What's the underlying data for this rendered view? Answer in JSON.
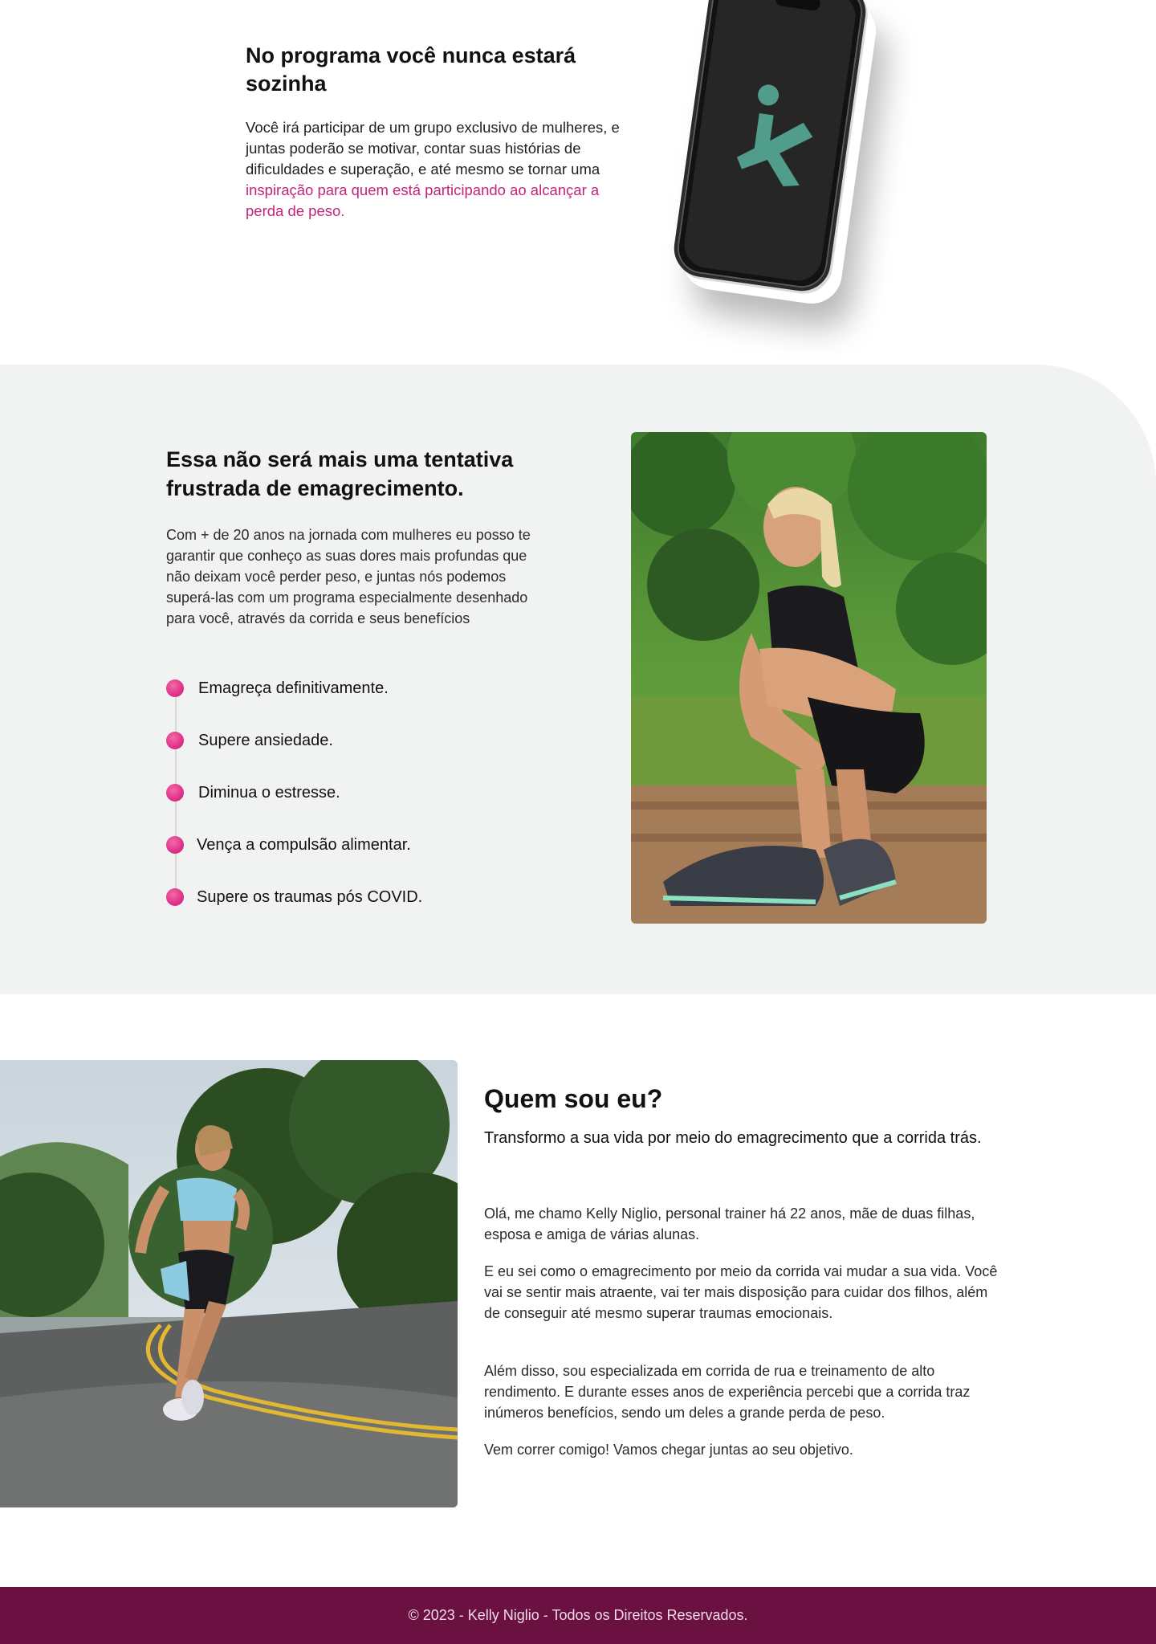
{
  "section1": {
    "title": "No programa você nunca estará sozinha",
    "text_plain": "Você irá participar de um grupo exclusivo de mulheres, e juntas poderão se motivar, contar suas histórias de dificuldades e superação, e até mesmo se tornar uma ",
    "text_highlight": "inspiração para quem está participando ao alcançar a perda de peso.",
    "phone_logo_icon": "running-person-logo-icon",
    "colors": {
      "highlight": "#c4237a",
      "logo": "#4f9d8a"
    }
  },
  "section2": {
    "title_1": "Essa ",
    "title_bold_1": "não",
    "title_2": " será mais uma ",
    "title_bold_2": "tentativa frustrada",
    "title_3": " de emagrecimento.",
    "text": "Com + de 20 anos na jornada com mulheres eu posso te garantir que conheço as suas dores mais profundas que não deixam você perder peso, e juntas nós podemos superá-las com um programa especialmente desenhado para você, através da corrida e seus benefícios",
    "benefits": [
      "Emagreça definitivamente.",
      "Supere ansiedade.",
      "Diminua o estresse.",
      "Vença a compulsão alimentar.",
      "Supere os traumas pós COVID."
    ],
    "colors": {
      "background": "#f1f3f2",
      "dot": "#e0318a"
    }
  },
  "section3": {
    "title": "Quem sou eu?",
    "subtitle": "Transformo a sua vida por meio do emagrecimento que a corrida trás.",
    "paragraphs": [
      "Olá, me chamo Kelly Niglio, personal trainer há 22 anos, mãe de duas filhas, esposa e amiga de várias alunas.",
      "E eu sei como o emagrecimento por meio da corrida vai mudar a sua vida. Você vai se sentir mais atraente, vai ter mais disposição para cuidar dos filhos, além de conseguir até mesmo superar traumas emocionais.",
      "Além disso, sou especializada em corrida de rua e treinamento de alto rendimento. E durante esses anos de experiência percebi que a corrida traz inúmeros benefícios, sendo um deles a grande perda de peso.",
      "Vem correr comigo! Vamos chegar juntas ao seu objetivo."
    ]
  },
  "footer": {
    "text": "© 2023 - Kelly Niglio - Todos os Direitos Reservados.",
    "colors": {
      "background": "#6b1142"
    }
  }
}
